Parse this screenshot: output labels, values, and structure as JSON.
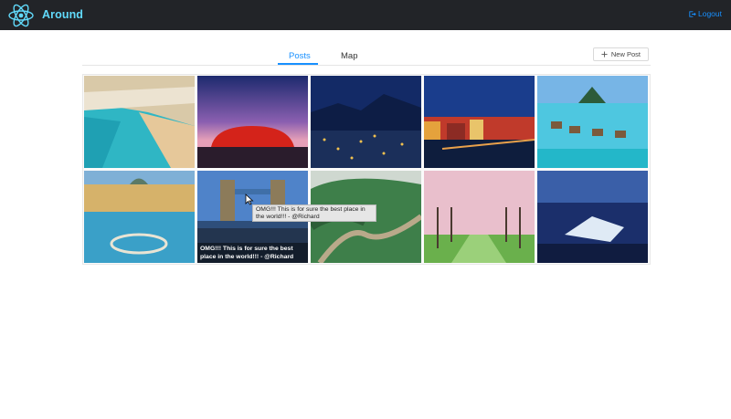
{
  "app": {
    "title": "Around",
    "logo_icon": "react-atom-icon",
    "brand_color": "#61dafb"
  },
  "header": {
    "logout_label": "Logout",
    "logout_icon": "logout-icon"
  },
  "tabs": [
    {
      "label": "Posts",
      "active": true
    },
    {
      "label": "Map",
      "active": false
    }
  ],
  "toolbar": {
    "new_post_label": "New Post",
    "new_post_icon": "plus-icon"
  },
  "gallery": {
    "hover_caption": "OMG!!! This is for sure the best place in the world!!! - @Richard",
    "tooltip": "OMG!!! This is for sure the best place in the world!!! - @Richard"
  }
}
